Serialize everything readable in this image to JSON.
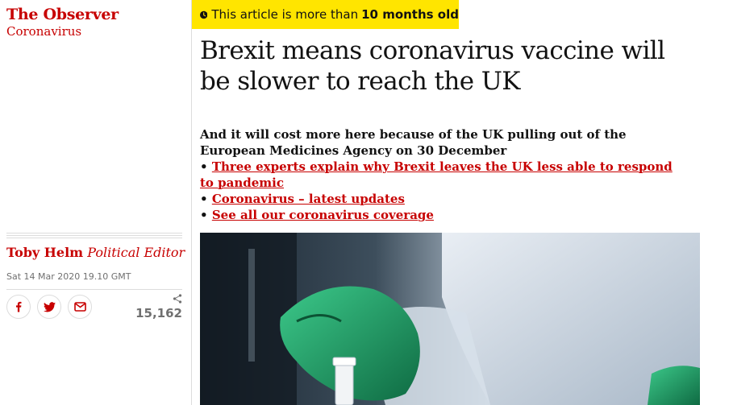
{
  "colors": {
    "brand_red": "#c70000",
    "banner_yellow": "#ffe500",
    "glove_green": "#1f9a63"
  },
  "masthead": {
    "pillar": "The Observer",
    "series": "Coronavirus"
  },
  "age_warning": {
    "icon": "clock-icon",
    "prefix": "This article is more than",
    "bold": "10 months old"
  },
  "headline": "Brexit means coronavirus vaccine will be slower to reach the UK",
  "standfirst": {
    "text": "And it will cost more here because of the UK pulling out of the European Medicines Agency on 30 December",
    "links": [
      "Three experts explain why Brexit leaves the UK less able to respond to pandemic",
      "Coronavirus – latest updates",
      "See all our coronavirus coverage"
    ]
  },
  "byline": {
    "name": "Toby Helm",
    "role": "Political Editor"
  },
  "dateline": "Sat 14 Mar 2020 19.10 GMT",
  "share": {
    "buttons": [
      "facebook-icon",
      "twitter-icon",
      "email-icon"
    ],
    "count_icon": "share-icon",
    "count": "15,162"
  },
  "image": {
    "subject": "lab-worker-green-gloves-vial"
  }
}
